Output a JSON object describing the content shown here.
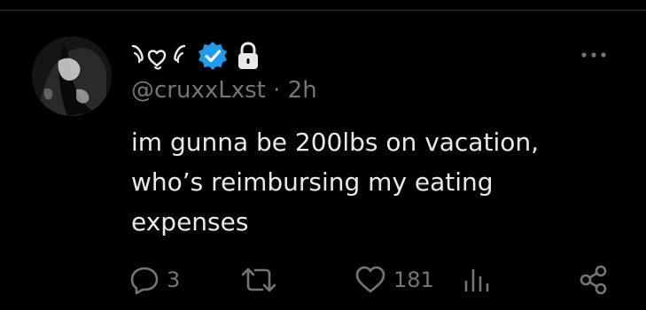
{
  "tweet": {
    "display_name": "ʚ♡ɞ",
    "handle": "@cruxxLxst",
    "separator": " · ",
    "time": "2h",
    "text_lines": [
      "im gunna be 200lbs on vacation,",
      "who’s reimbursing my eating",
      "expenses"
    ],
    "badges": [
      "verified-icon",
      "lock-icon"
    ]
  },
  "actions": {
    "replies": "3",
    "retweets": "",
    "likes": "181",
    "views": ""
  },
  "icons": {
    "more": "more-horizontal-icon",
    "reply": "reply-icon",
    "retweet": "retweet-icon",
    "like": "heart-icon",
    "views": "views-icon",
    "share": "share-icon"
  },
  "colors": {
    "background": "#000000",
    "text": "#e7e9ea",
    "secondary": "#71767b",
    "verified": "#1d9bf0",
    "divider": "#2f3336"
  }
}
